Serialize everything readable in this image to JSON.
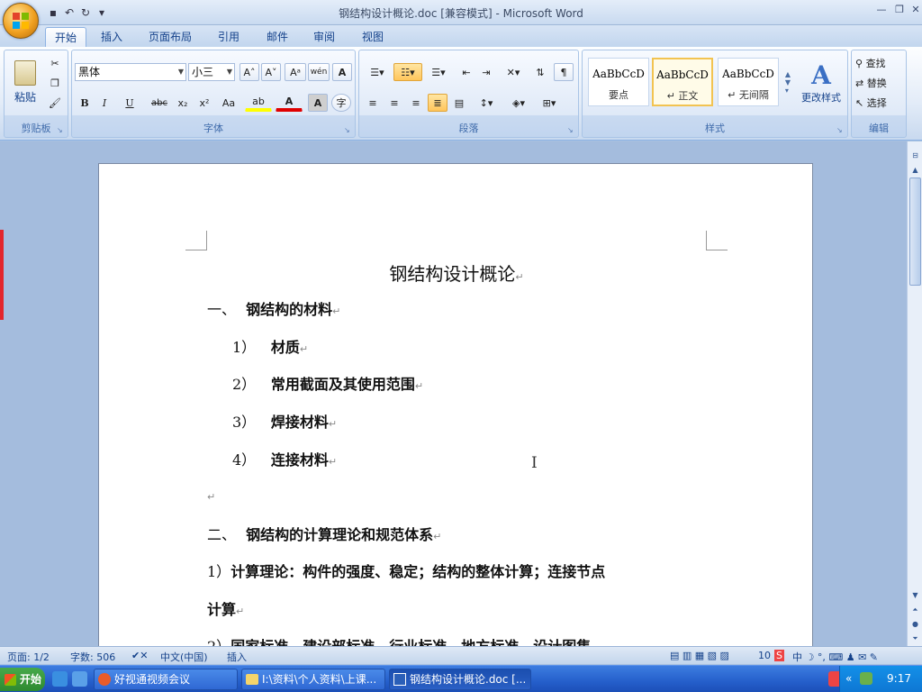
{
  "window": {
    "title": "钢结构设计概论.doc [兼容模式] - Microsoft Word",
    "minimize": "—",
    "restore": "❐",
    "close": "✕"
  },
  "qat": {
    "save": "▪",
    "undo": "↶",
    "redo": "↻",
    "customize": "▾"
  },
  "tabs": [
    {
      "label": "开始",
      "active": true
    },
    {
      "label": "插入"
    },
    {
      "label": "页面布局"
    },
    {
      "label": "引用"
    },
    {
      "label": "邮件"
    },
    {
      "label": "审阅"
    },
    {
      "label": "视图"
    }
  ],
  "ribbon": {
    "clipboard": {
      "label": "剪贴板",
      "paste": "粘贴"
    },
    "font": {
      "label": "字体",
      "font_name": "黑体",
      "font_size": "小三",
      "grow": "A˄",
      "shrink": "A˅",
      "clear": "Aᵃ",
      "phonetic": "wén",
      "border": "A",
      "bold": "B",
      "italic": "I",
      "underline": "U",
      "strike": "abc",
      "subscript": "x₂",
      "superscript": "x²",
      "case": "Aa",
      "highlight": "ab",
      "color": "A",
      "shade": "A",
      "enclose": "字"
    },
    "paragraph": {
      "label": "段落"
    },
    "styles": {
      "label": "样式",
      "items": [
        {
          "sample": "AaBbCcD",
          "name": "要点"
        },
        {
          "sample": "AaBbCcD",
          "name": "↵ 正文",
          "selected": true
        },
        {
          "sample": "AaBbCcD",
          "name": "↵ 无间隔"
        }
      ],
      "change": "更改样式"
    },
    "editing": {
      "label": "编辑",
      "find": "查找",
      "replace": "替换",
      "select": "选择"
    }
  },
  "document": {
    "title": "钢结构设计概论",
    "paragraphs": [
      {
        "num": "一、",
        "text": "钢结构的材料"
      },
      {
        "num": "1）",
        "text": "材质"
      },
      {
        "num": "2）",
        "text": "常用截面及其使用范围"
      },
      {
        "num": "3）",
        "text": "焊接材料"
      },
      {
        "num": "4）",
        "text": "连接材料"
      },
      {
        "num": "",
        "text": ""
      },
      {
        "num": "二、",
        "text": "钢结构的计算理论和规范体系"
      },
      {
        "num": "1）",
        "text": "计算理论：构件的强度、稳定；结构的整体计算；连接节点"
      },
      {
        "num": "",
        "text": "计算"
      },
      {
        "num": "2）",
        "text": "国家标准、建设部标准、行业标准、地方标准、设计图集"
      }
    ],
    "paragraph_mark": "↵",
    "cursor": "I"
  },
  "statusbar": {
    "page": "页面: 1/2",
    "words": "字数: 506",
    "language": "中文(中国)",
    "mode": "插入",
    "zoom": "10"
  },
  "taskbar": {
    "start": "开始",
    "buttons": [
      {
        "label": "好视通视频会议"
      },
      {
        "label": "I:\\资料\\个人资料\\上课..."
      },
      {
        "label": "钢结构设计概论.doc [...",
        "active": true
      }
    ],
    "clock": "9:17"
  }
}
